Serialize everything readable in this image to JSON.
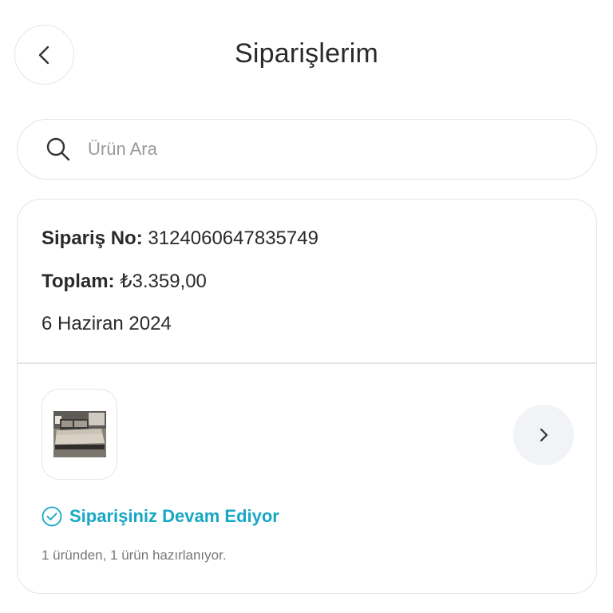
{
  "header": {
    "title": "Siparişlerim",
    "back_icon": "chevron-left-icon"
  },
  "search": {
    "placeholder": "Ürün Ara",
    "value": "",
    "icon": "search-icon"
  },
  "order": {
    "number_label": "Sipariş No:",
    "number_value": " 3124060647835749",
    "total_label": "Toplam:",
    "total_value": " ₺3.359,00",
    "date": "6 Haziran 2024",
    "product_image": "bed-product-thumbnail",
    "detail_icon": "chevron-right-icon",
    "status_icon": "check-circle-icon",
    "status": "Siparişiniz Devam Ediyor",
    "status_detail": "1 üründen, 1 ürün hazırlanıyor.",
    "status_color": "#17a7c4"
  }
}
